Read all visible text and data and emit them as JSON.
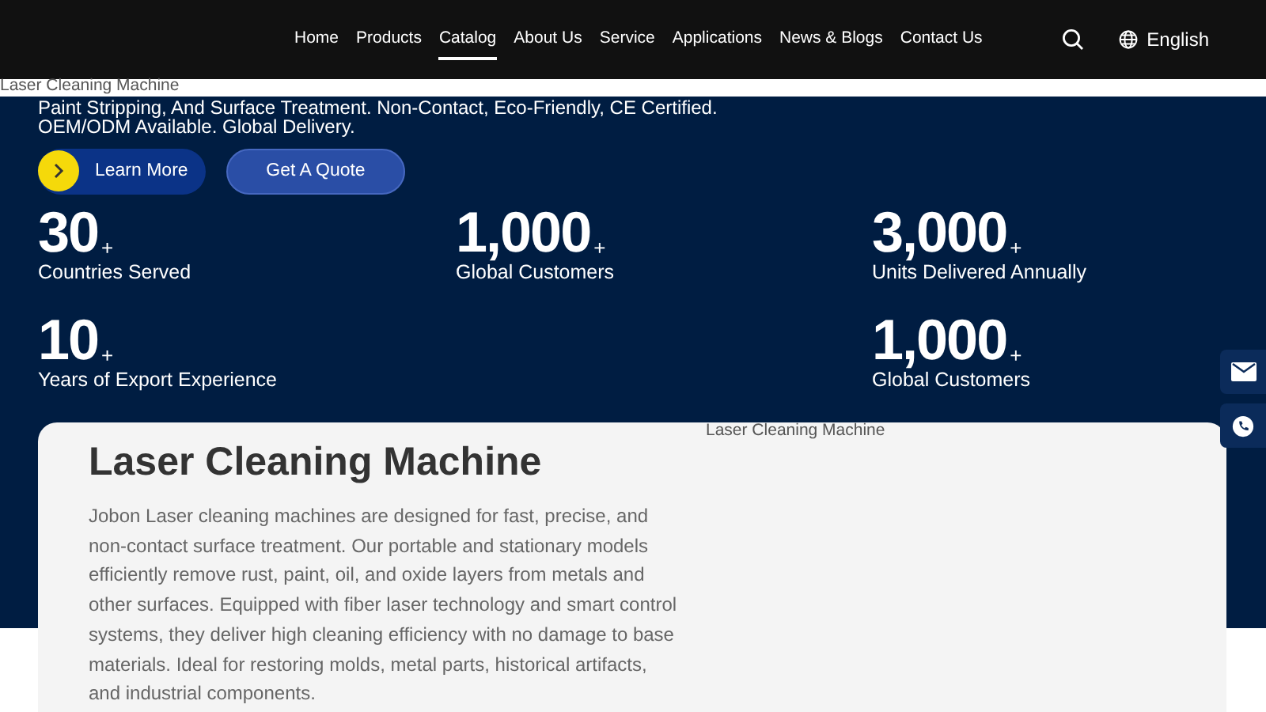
{
  "nav": {
    "items": [
      {
        "label": "Home",
        "selected": false
      },
      {
        "label": "Products",
        "selected": false
      },
      {
        "label": "Catalog",
        "selected": true
      },
      {
        "label": "About Us",
        "selected": false
      },
      {
        "label": "Service",
        "selected": false
      },
      {
        "label": "Applications",
        "selected": false
      },
      {
        "label": "News & Blogs",
        "selected": false
      },
      {
        "label": "Contact Us",
        "selected": false
      }
    ],
    "language": "English"
  },
  "banner_alt": "Laser Cleaning Machine",
  "hero": {
    "text": "Paint Stripping, And Surface Treatment. Non-Contact, Eco-Friendly, CE Certified. OEM/ODM Available. Global Delivery.",
    "buttons": [
      {
        "label": "Learn More",
        "kind": "primary"
      },
      {
        "label": "Get A Quote",
        "kind": "secondary"
      }
    ],
    "stat_columns": [
      [
        {
          "value": "30",
          "suffix": "+",
          "label": "Countries Served"
        },
        {
          "value": "10",
          "suffix": "+",
          "label": "Years of Export Experience"
        }
      ],
      [
        {
          "value": "1,000",
          "suffix": "+",
          "label": "Global Customers"
        }
      ],
      [
        {
          "value": "3,000",
          "suffix": "+",
          "label": "Units Delivered Annually"
        },
        {
          "value": "1,000",
          "suffix": "+",
          "label": "Global Customers"
        }
      ]
    ]
  },
  "card": {
    "title": "Laser Cleaning Machine",
    "text": "Jobon Laser cleaning machines are designed for fast, precise, and non-contact surface treatment. Our portable and stationary models efficiently remove rust, paint, oil, and oxide layers from metals and other surfaces. Equipped with fiber laser technology and smart control systems, they deliver high cleaning efficiency with no damage to base materials. Ideal for restoring molds, metal parts, historical artifacts, and industrial components.",
    "image_alt": "Laser Cleaning Machine"
  }
}
